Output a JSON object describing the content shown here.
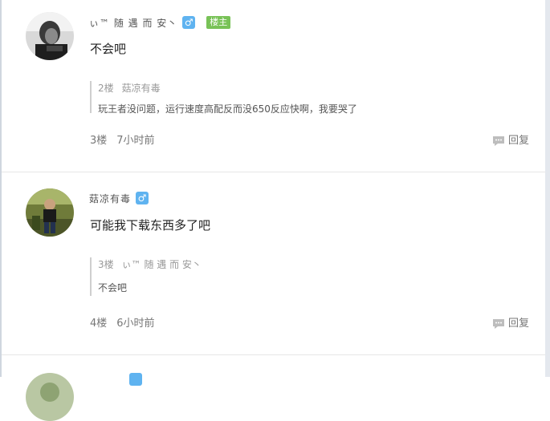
{
  "posts": [
    {
      "username": "ぃ™ 随 遇 而 安丶",
      "gender_symbol": "♂",
      "op_badge": "楼主",
      "content": "不会吧",
      "quote": {
        "floor": "2楼",
        "author": "菇凉有毒",
        "text": "玩王者没问题，运行速度高配反而没650反应快啊，我要哭了"
      },
      "floor": "3楼",
      "time": "7小时前",
      "reply_label": "回复"
    },
    {
      "username": "菇凉有毒",
      "gender_symbol": "♂",
      "content": "可能我下载东西多了吧",
      "quote": {
        "floor": "3楼",
        "author": "ぃ™ 随 遇 而 安丶",
        "text": "不会吧"
      },
      "floor": "4楼",
      "time": "6小时前",
      "reply_label": "回复"
    }
  ],
  "colors": {
    "gender_badge": "#5fb3f0",
    "op_badge": "#78c257",
    "divider": "#e6e6e6"
  },
  "icons": {
    "reply": "comment-bubble-icon"
  }
}
